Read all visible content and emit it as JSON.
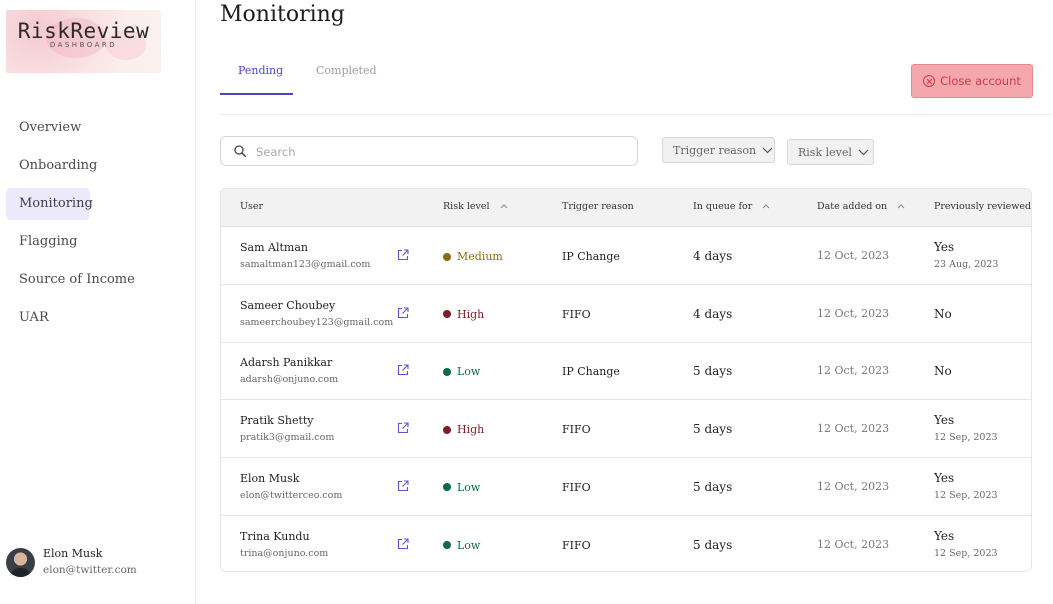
{
  "sidebar": {
    "logo": {
      "title": "RiskReview",
      "subtitle": "DASHBOARD"
    },
    "items": [
      {
        "label": "Overview",
        "active": false
      },
      {
        "label": "Onboarding",
        "active": false
      },
      {
        "label": "Monitoring",
        "active": true
      },
      {
        "label": "Flagging",
        "active": false
      },
      {
        "label": "Source of Income",
        "active": false
      },
      {
        "label": "UAR",
        "active": false
      }
    ],
    "user": {
      "name": "Elon Musk",
      "email": "elon@twitter.com"
    }
  },
  "main": {
    "title": "Monitoring",
    "tabs": [
      {
        "label": "Pending",
        "active": true
      },
      {
        "label": "Completed",
        "active": false
      }
    ],
    "close_button": {
      "label": "Close account",
      "icon": "x-circle-icon"
    },
    "search": {
      "placeholder": "Search",
      "value": ""
    },
    "filters": [
      {
        "label": "Trigger reason",
        "icon": "chevron-down-icon"
      },
      {
        "label": "Risk level",
        "icon": "chevron-down-icon"
      }
    ],
    "table": {
      "columns": [
        {
          "label": "User",
          "sortable": false
        },
        {
          "label": "Risk level",
          "sortable": true
        },
        {
          "label": "Trigger reason",
          "sortable": false
        },
        {
          "label": "In queue for",
          "sortable": true
        },
        {
          "label": "Date added on",
          "sortable": true
        },
        {
          "label": "Previously reviewed",
          "sortable": false
        }
      ],
      "rows": [
        {
          "name": "Sam Altman",
          "email": "samaltman123@gmail.com",
          "risk": "Medium",
          "trigger": "IP Change",
          "queue": "4 days",
          "date": "12 Oct, 2023",
          "reviewed": "Yes",
          "reviewed_date": "23 Aug, 2023"
        },
        {
          "name": "Sameer Choubey",
          "email": "sameerchoubey123@gmail.com",
          "risk": "High",
          "trigger": "FIFO",
          "queue": "4 days",
          "date": "12 Oct, 2023",
          "reviewed": "No",
          "reviewed_date": ""
        },
        {
          "name": "Adarsh Panikkar",
          "email": "adarsh@onjuno.com",
          "risk": "Low",
          "trigger": "IP Change",
          "queue": "5 days",
          "date": "12 Oct, 2023",
          "reviewed": "No",
          "reviewed_date": ""
        },
        {
          "name": "Pratik Shetty",
          "email": "pratik3@gmail.com",
          "risk": "High",
          "trigger": "FIFO",
          "queue": "5 days",
          "date": "12 Oct, 2023",
          "reviewed": "Yes",
          "reviewed_date": "12 Sep, 2023"
        },
        {
          "name": "Elon Musk",
          "email": "elon@twitterceo.com",
          "risk": "Low",
          "trigger": "FIFO",
          "queue": "5 days",
          "date": "12 Oct, 2023",
          "reviewed": "Yes",
          "reviewed_date": "12 Sep, 2023"
        },
        {
          "name": "Trina Kundu",
          "email": "trina@onjuno.com",
          "risk": "Low",
          "trigger": "FIFO",
          "queue": "5 days",
          "date": "12 Oct, 2023",
          "reviewed": "Yes",
          "reviewed_date": "12 Sep, 2023"
        }
      ]
    }
  },
  "colors": {
    "accent": "#4b47c9",
    "risk": {
      "Medium": "#8a6a14",
      "High": "#7a1f27",
      "Low": "#0e6b45"
    },
    "close_button_bg": "#f4a7ad",
    "close_button_text": "#cf3b48"
  }
}
